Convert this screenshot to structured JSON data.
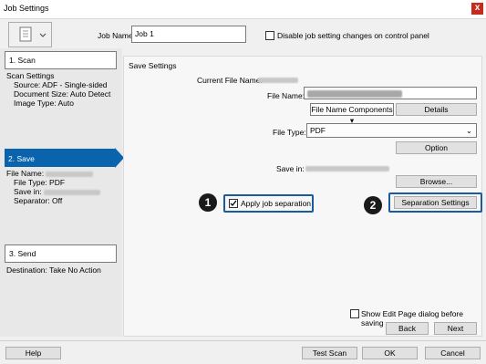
{
  "window": {
    "title": "Job Settings",
    "close_glyph": "x"
  },
  "header": {
    "job_name_label": "Job Name",
    "job_name_value": "Job 1",
    "disable_label": "Disable job setting changes on control panel"
  },
  "steps": [
    {
      "label": "1. Scan",
      "details": [
        "Scan Settings",
        "Source: ADF - Single-sided",
        "Document Size: Auto Detect",
        "Image Type: Auto"
      ]
    },
    {
      "label": "2. Save",
      "details": [
        "File Name:",
        "File Type: PDF",
        "Save in:",
        "Separator: Off"
      ]
    },
    {
      "label": "3. Send",
      "details": [
        "Destination: Take No Action"
      ]
    }
  ],
  "save": {
    "section_title": "Save Settings",
    "current_file_name_label": "Current File Name:",
    "file_name_label": "File Name:",
    "file_name_components": "File Name Components",
    "details_button": "Details",
    "file_type_label": "File Type:",
    "file_type_value": "PDF",
    "option_button": "Option",
    "save_in_label": "Save in:",
    "browse_button": "Browse...",
    "apply_separation": "Apply job separation",
    "separation_settings": "Separation Settings",
    "show_edit_page": "Show Edit Page dialog before saving",
    "back_button": "Back",
    "next_button": "Next"
  },
  "callouts": {
    "one": "1",
    "two": "2"
  },
  "footer": {
    "help": "Help",
    "test_scan": "Test Scan",
    "ok": "OK",
    "cancel": "Cancel"
  },
  "colors": {
    "accent": "#1a5a9e",
    "selected_step": "#0a64ad"
  }
}
